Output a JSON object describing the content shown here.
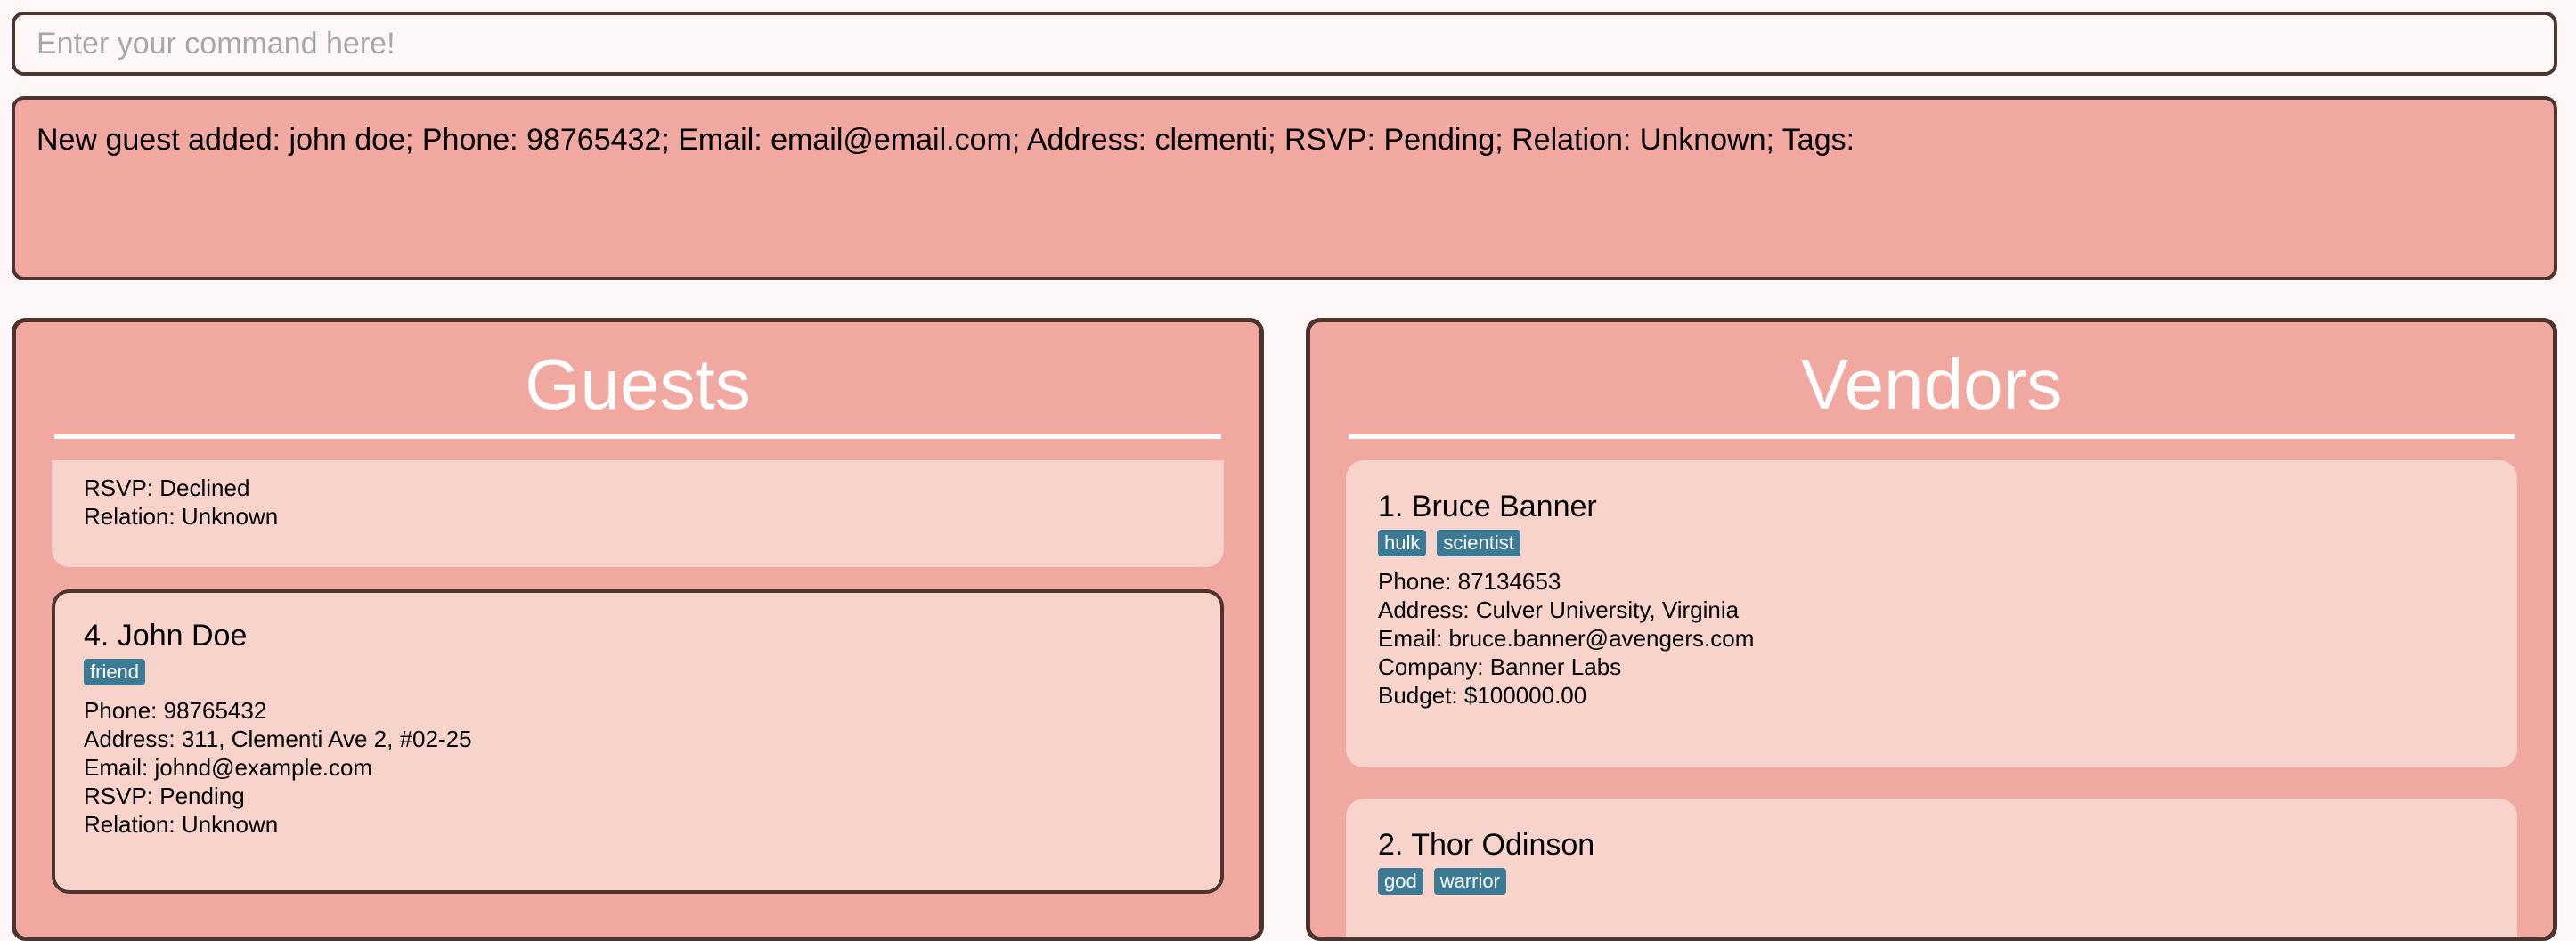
{
  "command": {
    "placeholder": "Enter your command here!",
    "value": ""
  },
  "result": {
    "text": "New guest added: john  doe; Phone: 98765432; Email: email@email.com; Address: clementi; RSVP: Pending; Relation: Unknown; Tags:"
  },
  "guests": {
    "title": "Guests",
    "partial_card": {
      "rsvp": "RSVP: Declined",
      "relation": "Relation: Unknown"
    },
    "cards": [
      {
        "name": "4. John Doe",
        "tags": [
          "friend"
        ],
        "phone": "Phone: 98765432",
        "address": "Address: 311, Clementi Ave 2, #02-25",
        "email": "Email: johnd@example.com",
        "rsvp": "RSVP: Pending",
        "relation": "Relation: Unknown"
      }
    ]
  },
  "vendors": {
    "title": "Vendors",
    "cards": [
      {
        "name": "1. Bruce Banner",
        "tags": [
          "hulk",
          "scientist"
        ],
        "phone": "Phone: 87134653",
        "address": "Address: Culver University, Virginia",
        "email": "Email: bruce.banner@avengers.com",
        "company": "Company: Banner Labs",
        "budget": "Budget: $100000.00"
      },
      {
        "name": "2. Thor Odinson",
        "tags": [
          "god",
          "warrior"
        ]
      }
    ]
  },
  "colors": {
    "border": "#4e342e",
    "panel_bg": "#f0a8a0",
    "card_bg": "#f8d3cb",
    "tag_bg": "#3a7a94"
  }
}
